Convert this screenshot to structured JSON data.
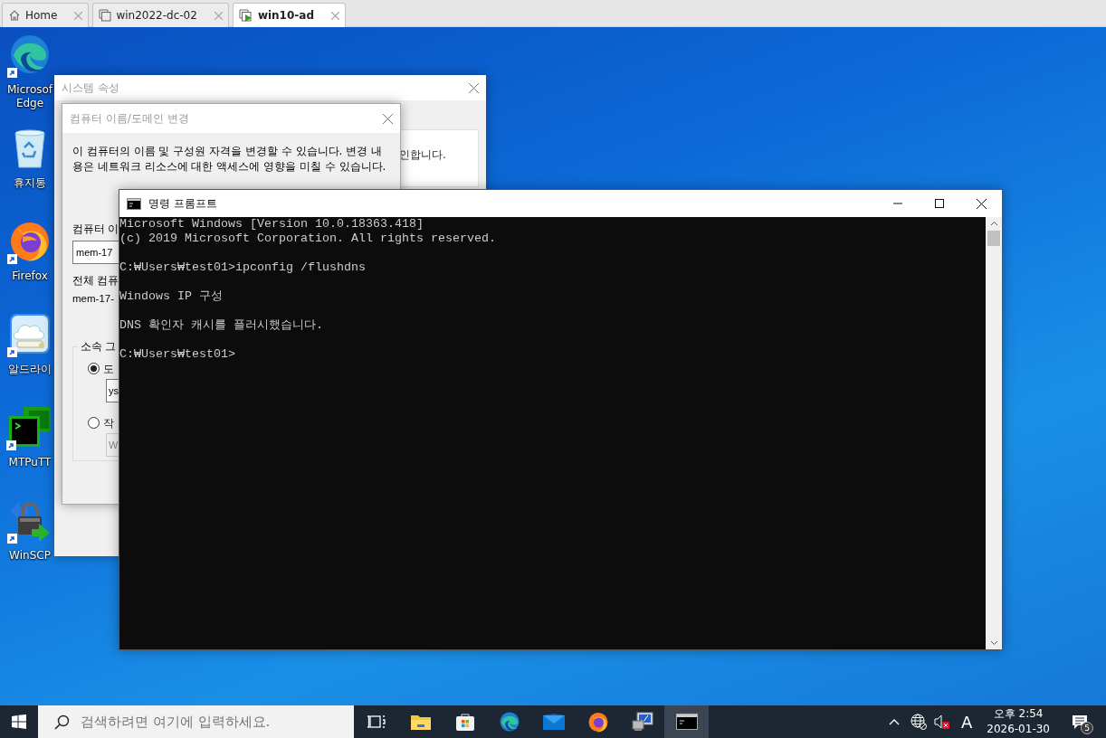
{
  "vm_tabs": [
    {
      "kind": "home",
      "label": "Home",
      "selected": false
    },
    {
      "kind": "vm",
      "label": "win2022-dc-02",
      "selected": false
    },
    {
      "kind": "vm-running",
      "label": "win10-ad",
      "selected": true
    }
  ],
  "desktop_icons": [
    {
      "kind": "edge",
      "lines": [
        "Microsof",
        "Edge"
      ]
    },
    {
      "kind": "recycle-bin",
      "lines": [
        "휴지통"
      ]
    },
    {
      "kind": "firefox",
      "lines": [
        "Firefox"
      ]
    },
    {
      "kind": "cloud-drive",
      "lines": [
        "알드라이"
      ]
    },
    {
      "kind": "terminal",
      "lines": [
        "MTPuTT"
      ]
    },
    {
      "kind": "padlock",
      "lines": [
        "WinSCP"
      ]
    }
  ],
  "system_properties": {
    "title": "시스템 속성",
    "partial_text": "인합니다."
  },
  "rename_dialog": {
    "title": "컴퓨터 이름/도메인 변경",
    "description": "이 컴퓨터의 이름 및 구성원 자격을 변경할 수 있습니다. 변경 내용은 네트워크 리소스에 대한 액세스에 영향을 미칠 수 있습니다.",
    "computer_name_label": "컴퓨터 이",
    "computer_name_value": "mem-17",
    "full_name_label": "전체 컴퓨",
    "full_name_value": "mem-17-",
    "member_of_label": "소속 그",
    "options": [
      {
        "label": "도",
        "value": "ys",
        "selected": true,
        "disabled": false
      },
      {
        "label": "작",
        "value": "W",
        "selected": false,
        "disabled": true
      }
    ]
  },
  "console": {
    "title": "명령 프롬프트",
    "blocks": [
      {
        "lines": [
          "Microsoft Windows [Version 10.0.18363.418]",
          "(c) 2019 Microsoft Corporation. All rights reserved."
        ]
      },
      {
        "lines": [
          "C:₩Users₩test01>ipconfig /flushdns"
        ]
      },
      {
        "lines": [
          "Windows IP 구성"
        ]
      },
      {
        "lines": [
          "DNS 확인자 캐시를 플러시했습니다."
        ]
      },
      {
        "lines": [
          "C:₩Users₩test01>"
        ]
      }
    ]
  },
  "taskbar": {
    "search": {
      "placeholder": "검색하려면 여기에 입력하세요."
    },
    "apps": [
      {
        "kind": "task-view",
        "selected": false
      },
      {
        "kind": "folder",
        "selected": false
      },
      {
        "kind": "store",
        "selected": false
      },
      {
        "kind": "edge",
        "selected": false
      },
      {
        "kind": "mail",
        "selected": false
      },
      {
        "kind": "firefox",
        "selected": false
      },
      {
        "kind": "monitor",
        "selected": false
      },
      {
        "kind": "terminal-window",
        "selected": true
      }
    ],
    "input_indicator": "A",
    "clock": {
      "time": "오후 2:54",
      "date": "2026-01-30"
    },
    "notifications": {
      "count": "5"
    }
  }
}
